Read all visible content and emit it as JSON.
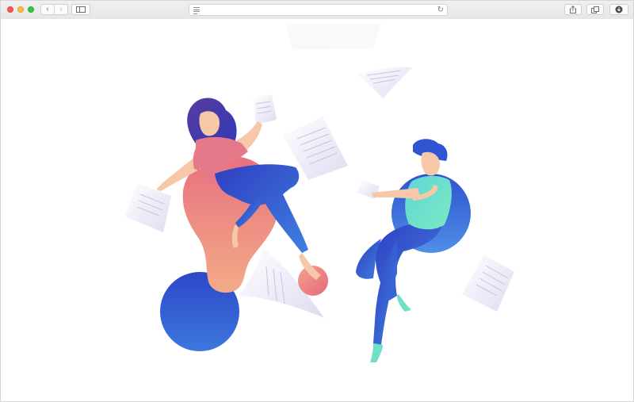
{
  "browser": {
    "toolbar": {
      "back_icon": "chevron-left-icon",
      "forward_icon": "chevron-right-icon",
      "sidebar_icon": "sidebar-icon",
      "share_icon": "share-icon",
      "tabs_icon": "tabs-icon",
      "download_icon": "download-icon"
    },
    "address_bar": {
      "value": "",
      "reader_icon": "reader-icon",
      "reload_icon": "reload-icon"
    }
  },
  "colors": {
    "accent_blue": "#2f5fd0",
    "pink": "#e87b86",
    "mint": "#6fe0c7"
  },
  "illustration": {
    "subject": "people-with-papers-illustration"
  }
}
